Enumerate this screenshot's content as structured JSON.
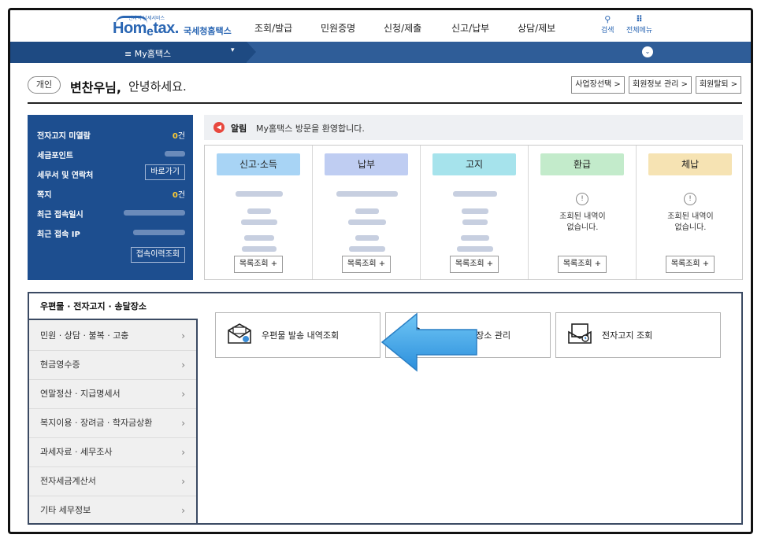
{
  "header": {
    "logo_tiny": "전자적 납세서비스",
    "logo_brand_a": "Hom",
    "logo_brand_e": "e",
    "logo_brand_b": "tax.",
    "logo_sub": "국세청홈택스",
    "menu": [
      "조회/발급",
      "민원증명",
      "신청/제출",
      "신고/납부",
      "상담/제보"
    ],
    "search_label": "검색",
    "allmenu_label": "전체메뉴"
  },
  "subnav": {
    "label": "≡ My홈택스",
    "caret": "▾",
    "circle": "⌄"
  },
  "greeting": {
    "pill": "개인",
    "name": "변찬우님,",
    "message": "안녕하세요.",
    "buttons": [
      "사업장선택 >",
      "회원정보 관리 >",
      "회원탈퇴 >"
    ]
  },
  "summary": {
    "rows": [
      {
        "label": "전자고지 미열람",
        "value": "0",
        "unit": "건"
      },
      {
        "label": "세금포인트"
      },
      {
        "label": "세무서 및 연락처",
        "button": "바로가기"
      },
      {
        "label": "쪽지",
        "value": "0",
        "unit": "건"
      },
      {
        "label": "최근 접속일시"
      },
      {
        "label": "최근 접속 IP"
      }
    ],
    "history_button": "접속이력조회"
  },
  "notice": {
    "title": "알림",
    "text": "My홈택스 방문을 환영합니다."
  },
  "cards": [
    {
      "title": "신고·소득",
      "color": "#a8d4f5",
      "button": "목록조회 +"
    },
    {
      "title": "납부",
      "color": "#bfcdf2",
      "button": "목록조회 +"
    },
    {
      "title": "고지",
      "color": "#a6e3ec",
      "button": "목록조회 +"
    },
    {
      "title": "환급",
      "color": "#c3ebcb",
      "empty": [
        "조회된 내역이",
        "없습니다."
      ],
      "button": "목록조회 +"
    },
    {
      "title": "체납",
      "color": "#f6e3b3",
      "empty": [
        "조회된 내역이",
        "없습니다."
      ],
      "button": "목록조회 +"
    }
  ],
  "sidemenu": {
    "header": "우편물 · 전자고지 · 송달장소",
    "items": [
      "민원 · 상담 · 불복 · 고충",
      "현금영수증",
      "연말정산 · 지급명세서",
      "복지이용 · 장려금 · 학자금상환",
      "과세자료 · 세무조사",
      "전자세금계산서",
      "기타 세무정보"
    ]
  },
  "services": [
    "우편물 발송 내역조회",
    "달장소 관리",
    "전자고지 조회"
  ]
}
